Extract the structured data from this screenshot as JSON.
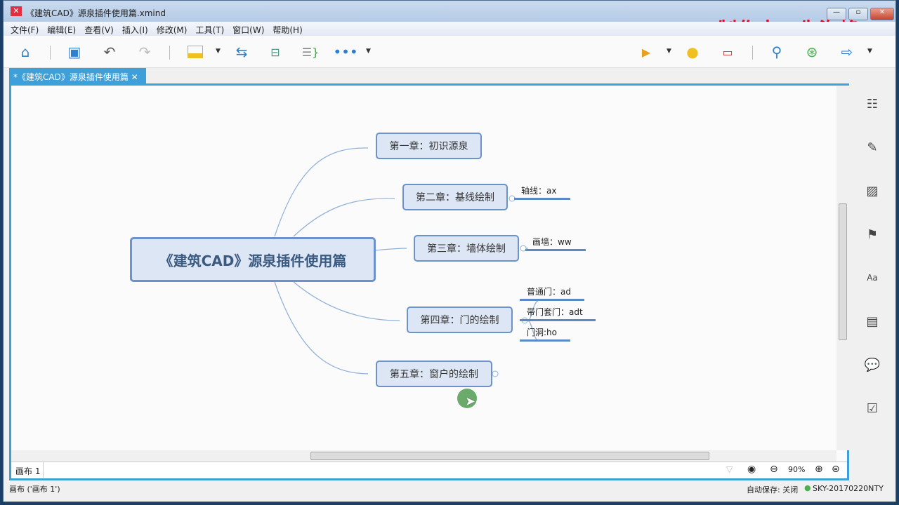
{
  "window": {
    "title": "《建筑CAD》源泉插件使用篇.xmind",
    "app_icon": "xmind-x-icon"
  },
  "watermark": "制作人：朱海峰",
  "menu": [
    "文件(F)",
    "编辑(E)",
    "查看(V)",
    "插入(I)",
    "修改(M)",
    "工具(T)",
    "窗口(W)",
    "帮助(H)"
  ],
  "toolbar": {
    "left": [
      "home-icon",
      "save-icon",
      "undo-icon",
      "redo-icon",
      "topic-icon",
      "relationship-icon",
      "boundary-icon",
      "summary-icon",
      "more-icon"
    ],
    "right": [
      "presentation-icon",
      "idea-icon",
      "gantt-icon",
      "search-icon",
      "share-icon",
      "export-icon"
    ]
  },
  "tab": {
    "label": "*《建筑CAD》源泉插件使用篇"
  },
  "colors": {
    "accent": "#3ea0da",
    "node_fill": "#dce6f4",
    "node_border": "#6b93c9",
    "watermark": "#e0001a"
  },
  "mindmap": {
    "central": "《建筑CAD》源泉插件使用篇",
    "branches": [
      {
        "label": "第一章：初识源泉",
        "children": []
      },
      {
        "label": "第二章：基线绘制",
        "children": [
          "轴线：ax"
        ]
      },
      {
        "label": "第三章：墙体绘制",
        "children": [
          "画墙：ww"
        ]
      },
      {
        "label": "第四章：门的绘制",
        "children": [
          "普通门：ad",
          "带门套门：adt",
          "门洞:ho"
        ]
      },
      {
        "label": "第五章：窗户的绘制",
        "children": [],
        "collapsed": true
      }
    ]
  },
  "sheet": {
    "tab": "画布 1",
    "zoom": "90%"
  },
  "status": {
    "left": "画布 ('画布 1')",
    "autosave": "自动保存: 关闭",
    "user": "SKY-20170220NTY"
  }
}
